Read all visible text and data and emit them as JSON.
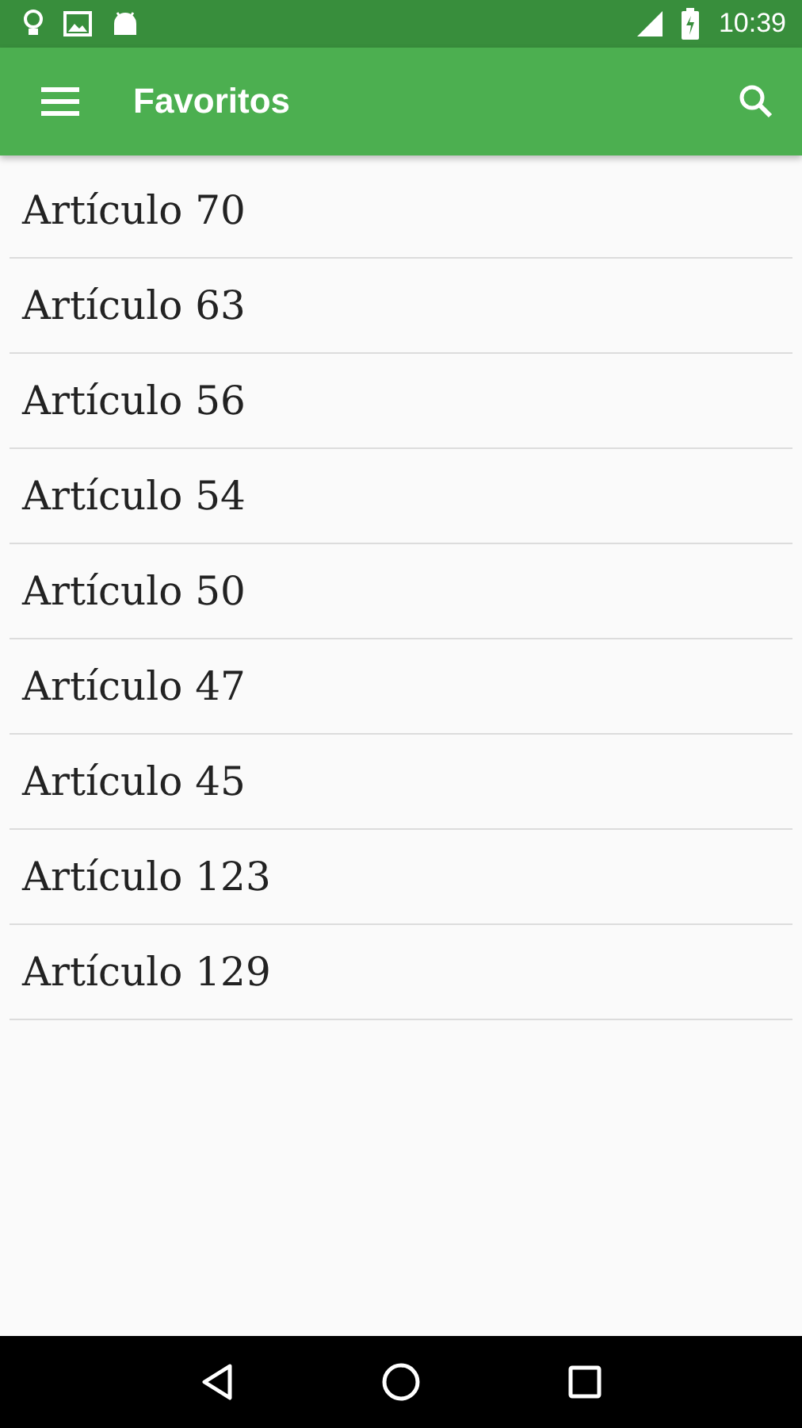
{
  "status_bar": {
    "time": "10:39"
  },
  "app_bar": {
    "title": "Favoritos"
  },
  "items": [
    {
      "label": "Artículo 70"
    },
    {
      "label": "Artículo 63"
    },
    {
      "label": "Artículo 56"
    },
    {
      "label": "Artículo 54"
    },
    {
      "label": "Artículo 50"
    },
    {
      "label": "Artículo 47"
    },
    {
      "label": "Artículo 45"
    },
    {
      "label": "Artículo 123"
    },
    {
      "label": "Artículo 129"
    }
  ]
}
